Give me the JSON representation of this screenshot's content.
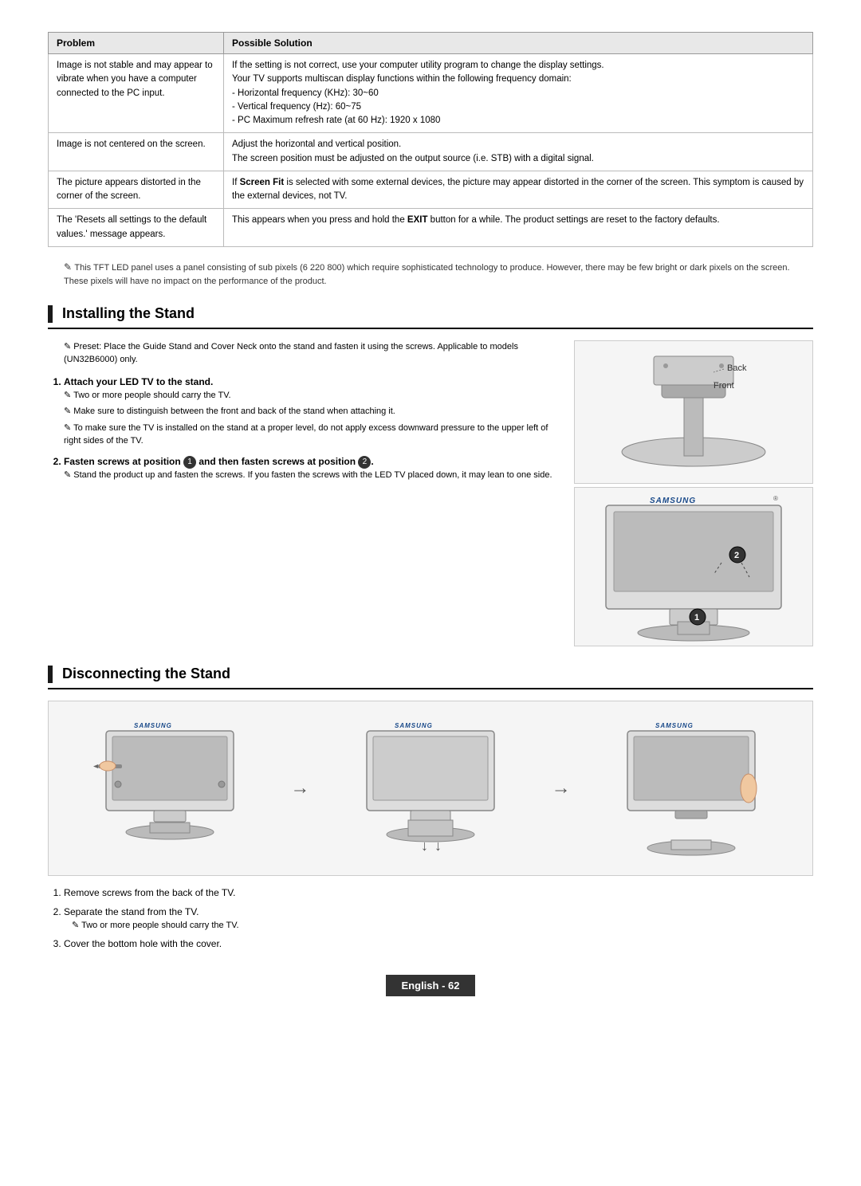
{
  "table": {
    "headers": [
      "Problem",
      "Possible Solution"
    ],
    "rows": [
      {
        "problem": "Image is not stable and may appear to vibrate when you have a computer connected to the PC input.",
        "solution": "If the setting is not correct, use your computer utility program to change the display settings.\nYour TV supports multiscan display functions within the following frequency domain:\n- Horizontal frequency (KHz): 30~60\n- Vertical frequency (Hz): 60~75\n- PC Maximum refresh rate (at 60 Hz): 1920 x 1080"
      },
      {
        "problem": "Image is not centered on the screen.",
        "solution": "Adjust the horizontal and vertical position.\nThe screen position must be adjusted on the output source (i.e. STB) with a digital signal."
      },
      {
        "problem": "The picture appears distorted in the corner of the screen.",
        "solution": "If Screen Fit is selected with some external devices, the picture may appear distorted in the corner of the screen. This symptom is caused by the external devices, not TV."
      },
      {
        "problem": "The 'Resets all settings to the default values.' message appears.",
        "solution": "This appears when you press and hold the EXIT button for a while. The product settings are reset to the factory defaults."
      }
    ]
  },
  "tft_note": "This TFT LED panel uses a panel consisting of sub pixels (6 220 800) which require sophisticated technology to produce. However, there may be few bright or dark pixels on the screen. These pixels will have no impact on the performance of the product.",
  "installing": {
    "heading": "Installing the Stand",
    "preset_note": "Preset: Place the Guide Stand and Cover Neck onto the stand and fasten it using the screws. Applicable to models (UN32B6000) only.",
    "diagram_back_label": "Back",
    "diagram_front_label": "Front",
    "steps": [
      {
        "num": "1",
        "text": "Attach your LED TV to the stand.",
        "sub_notes": [
          "Two or more people should carry the TV.",
          "Make sure to distinguish between the front and back of the stand when attaching it.",
          "To make sure the TV is installed on the stand at a proper level, do not apply excess downward pressure to the upper left of right sides of the TV."
        ]
      },
      {
        "num": "2",
        "text": "Fasten screws at position ❶ and then fasten screws at position ❷.",
        "sub_notes": [
          "Stand the product up and fasten the screws. If you fasten the screws with the LED TV placed down, it may lean to one side."
        ]
      }
    ]
  },
  "disconnecting": {
    "heading": "Disconnecting the Stand",
    "steps": [
      {
        "num": "1",
        "text": "Remove screws from the back of the TV."
      },
      {
        "num": "2",
        "text": "Separate the stand from the TV.",
        "note": "Two or more people should carry the TV."
      },
      {
        "num": "3",
        "text": "Cover the bottom hole with the cover."
      }
    ]
  },
  "footer": {
    "label": "English - 62"
  }
}
